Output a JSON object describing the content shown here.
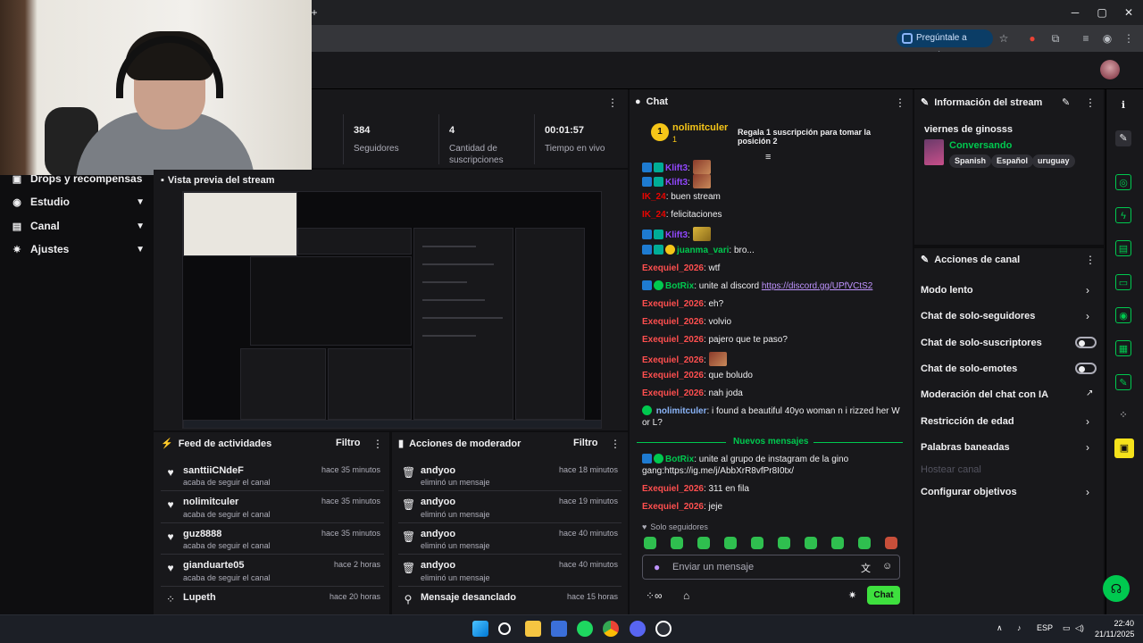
{
  "browser": {
    "ask_google": "Pregúntale a Google",
    "new_tab": "+",
    "minimize": "─",
    "maximize": "▢",
    "close": "✕"
  },
  "sidebar": {
    "items": [
      {
        "label": "Drops y recompensas",
        "icon": "gift-icon"
      },
      {
        "label": "Estudio",
        "icon": "studio-icon"
      },
      {
        "label": "Canal",
        "icon": "channel-icon"
      },
      {
        "label": "Ajustes",
        "icon": "gear-icon"
      }
    ]
  },
  "stats": [
    {
      "value": "384",
      "label": "Seguidores"
    },
    {
      "value": "4",
      "label": "Cantidad de suscripciones"
    },
    {
      "value": "00:01:57",
      "label": "Tiempo en vivo"
    }
  ],
  "preview": {
    "title": "Vista previa del stream"
  },
  "activity_feed": {
    "title": "Feed de actividades",
    "filter": "Filtro",
    "items": [
      {
        "name": "santtiiCNdeF",
        "sub": "acaba de seguir el canal",
        "time": "hace 35 minutos",
        "icon": "heart-icon"
      },
      {
        "name": "nolimitculer",
        "sub": "acaba de seguir el canal",
        "time": "hace 35 minutos",
        "icon": "heart-icon"
      },
      {
        "name": "guz8888",
        "sub": "acaba de seguir el canal",
        "time": "hace 35 minutos",
        "icon": "heart-icon"
      },
      {
        "name": "gianduarte05",
        "sub": "acaba de seguir el canal",
        "time": "hace 2 horas",
        "icon": "heart-icon"
      },
      {
        "name": "Lupeth",
        "sub": "",
        "time": "hace 20 horas",
        "icon": "points-icon"
      }
    ]
  },
  "mod_actions": {
    "title": "Acciones de moderador",
    "filter": "Filtro",
    "items": [
      {
        "name": "andyoo",
        "sub": "eliminó un mensaje",
        "time": "hace 18 minutos",
        "icon": "trash-icon"
      },
      {
        "name": "andyoo",
        "sub": "eliminó un mensaje",
        "time": "hace 19 minutos",
        "icon": "trash-icon"
      },
      {
        "name": "andyoo",
        "sub": "eliminó un mensaje",
        "time": "hace 40 minutos",
        "icon": "trash-icon"
      },
      {
        "name": "andyoo",
        "sub": "eliminó un mensaje",
        "time": "hace 40 minutos",
        "icon": "trash-icon"
      },
      {
        "name": "Mensaje desanclado",
        "sub": "",
        "time": "hace 15 horas",
        "icon": "unpin-icon"
      }
    ]
  },
  "chat": {
    "title": "Chat",
    "hype": {
      "rank": "1",
      "user": "nolimitculer",
      "count": "1",
      "cta": "Regala 1 suscripción para tomar la posición 2"
    },
    "messages": [
      {
        "user": "Klift3",
        "text": "",
        "color": "blue",
        "emote": "face"
      },
      {
        "user": "IK_24",
        "text": "buen stream",
        "color": "red"
      },
      {
        "user": "IK_24",
        "text": "felicitaciones",
        "color": "red"
      },
      {
        "user": "Klift3",
        "text": "",
        "color": "blue",
        "emote": "banana"
      },
      {
        "user": "juanma_vari",
        "text": "bro...",
        "color": "green"
      },
      {
        "user": "Exequiel_2026",
        "text": "wtf",
        "color": "exq"
      },
      {
        "user": "BotRix",
        "text": "unite al discord ",
        "link": "https://discord.gg/UPfVCtS2",
        "color": "green"
      },
      {
        "user": "Exequiel_2026",
        "text": "eh?",
        "color": "exq"
      },
      {
        "user": "Exequiel_2026",
        "text": "volvio",
        "color": "exq"
      },
      {
        "user": "Exequiel_2026",
        "text": "pajero que te paso?",
        "color": "exq"
      },
      {
        "user": "Exequiel_2026",
        "text": "",
        "color": "exq",
        "emote": "face"
      },
      {
        "user": "Exequiel_2026",
        "text": "que boludo",
        "color": "exq"
      },
      {
        "user": "Exequiel_2026",
        "text": "nah joda",
        "color": "exq"
      },
      {
        "user": "nolimitculer",
        "text": "i found a beautiful 40yo woman n i rizzed her W or L?",
        "color": "blue"
      }
    ],
    "new_messages_label": "Nuevos mensajes",
    "new_messages": [
      {
        "user": "BotRix",
        "text": "unite al grupo de instagram de la gino gang:https://ig.me/j/AbbXrR8vfPr8I0tx/",
        "color": "green"
      },
      {
        "user": "Exequiel_2026",
        "text": "311 en fila",
        "color": "exq"
      },
      {
        "user": "Exequiel_2026",
        "text": "jeje",
        "color": "exq"
      }
    ],
    "followers_only": "Solo seguidores",
    "input_placeholder": "Enviar un mensaje",
    "send_label": "Chat"
  },
  "stream_info": {
    "title": "Información del stream",
    "stream_title": "viernes de ginosss",
    "category": "Conversando",
    "tags": [
      "Spanish",
      "Español",
      "uruguay"
    ]
  },
  "channel_actions": {
    "title": "Acciones de canal",
    "items": [
      {
        "label": "Modo lento",
        "control": "chevron"
      },
      {
        "label": "Chat de solo-seguidores",
        "control": "chevron"
      },
      {
        "label": "Chat de solo-suscriptores",
        "control": "toggle"
      },
      {
        "label": "Chat de solo-emotes",
        "control": "toggle"
      },
      {
        "label": "Moderación del chat con IA",
        "control": "external"
      },
      {
        "label": "Restricción de edad",
        "control": "chevron"
      },
      {
        "label": "Palabras baneadas",
        "control": "chevron"
      },
      {
        "label": "Hostear canal",
        "control": "disabled"
      },
      {
        "label": "Configurar objetivos",
        "control": "chevron"
      }
    ]
  },
  "taskbar": {
    "lang": "ESP",
    "time": "22:40",
    "date": "21/11/2025"
  },
  "colors": {
    "accent_green": "#00c94f",
    "chat_button": "#3ee03e",
    "background": "#0e0e10",
    "panel": "#18181b"
  }
}
